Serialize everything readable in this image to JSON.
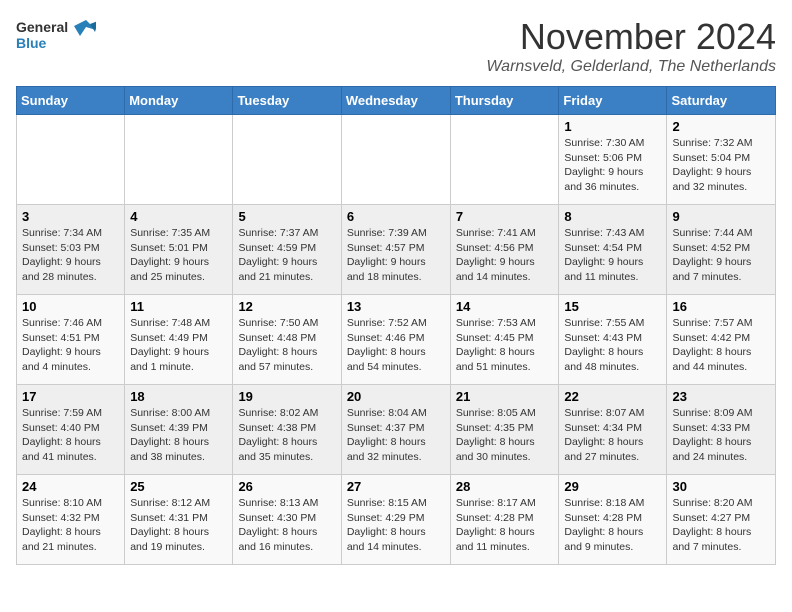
{
  "logo": {
    "line1": "General",
    "line2": "Blue"
  },
  "title": "November 2024",
  "location": "Warnsveld, Gelderland, The Netherlands",
  "weekdays": [
    "Sunday",
    "Monday",
    "Tuesday",
    "Wednesday",
    "Thursday",
    "Friday",
    "Saturday"
  ],
  "weeks": [
    [
      {
        "day": "",
        "info": ""
      },
      {
        "day": "",
        "info": ""
      },
      {
        "day": "",
        "info": ""
      },
      {
        "day": "",
        "info": ""
      },
      {
        "day": "",
        "info": ""
      },
      {
        "day": "1",
        "info": "Sunrise: 7:30 AM\nSunset: 5:06 PM\nDaylight: 9 hours and 36 minutes."
      },
      {
        "day": "2",
        "info": "Sunrise: 7:32 AM\nSunset: 5:04 PM\nDaylight: 9 hours and 32 minutes."
      }
    ],
    [
      {
        "day": "3",
        "info": "Sunrise: 7:34 AM\nSunset: 5:03 PM\nDaylight: 9 hours and 28 minutes."
      },
      {
        "day": "4",
        "info": "Sunrise: 7:35 AM\nSunset: 5:01 PM\nDaylight: 9 hours and 25 minutes."
      },
      {
        "day": "5",
        "info": "Sunrise: 7:37 AM\nSunset: 4:59 PM\nDaylight: 9 hours and 21 minutes."
      },
      {
        "day": "6",
        "info": "Sunrise: 7:39 AM\nSunset: 4:57 PM\nDaylight: 9 hours and 18 minutes."
      },
      {
        "day": "7",
        "info": "Sunrise: 7:41 AM\nSunset: 4:56 PM\nDaylight: 9 hours and 14 minutes."
      },
      {
        "day": "8",
        "info": "Sunrise: 7:43 AM\nSunset: 4:54 PM\nDaylight: 9 hours and 11 minutes."
      },
      {
        "day": "9",
        "info": "Sunrise: 7:44 AM\nSunset: 4:52 PM\nDaylight: 9 hours and 7 minutes."
      }
    ],
    [
      {
        "day": "10",
        "info": "Sunrise: 7:46 AM\nSunset: 4:51 PM\nDaylight: 9 hours and 4 minutes."
      },
      {
        "day": "11",
        "info": "Sunrise: 7:48 AM\nSunset: 4:49 PM\nDaylight: 9 hours and 1 minute."
      },
      {
        "day": "12",
        "info": "Sunrise: 7:50 AM\nSunset: 4:48 PM\nDaylight: 8 hours and 57 minutes."
      },
      {
        "day": "13",
        "info": "Sunrise: 7:52 AM\nSunset: 4:46 PM\nDaylight: 8 hours and 54 minutes."
      },
      {
        "day": "14",
        "info": "Sunrise: 7:53 AM\nSunset: 4:45 PM\nDaylight: 8 hours and 51 minutes."
      },
      {
        "day": "15",
        "info": "Sunrise: 7:55 AM\nSunset: 4:43 PM\nDaylight: 8 hours and 48 minutes."
      },
      {
        "day": "16",
        "info": "Sunrise: 7:57 AM\nSunset: 4:42 PM\nDaylight: 8 hours and 44 minutes."
      }
    ],
    [
      {
        "day": "17",
        "info": "Sunrise: 7:59 AM\nSunset: 4:40 PM\nDaylight: 8 hours and 41 minutes."
      },
      {
        "day": "18",
        "info": "Sunrise: 8:00 AM\nSunset: 4:39 PM\nDaylight: 8 hours and 38 minutes."
      },
      {
        "day": "19",
        "info": "Sunrise: 8:02 AM\nSunset: 4:38 PM\nDaylight: 8 hours and 35 minutes."
      },
      {
        "day": "20",
        "info": "Sunrise: 8:04 AM\nSunset: 4:37 PM\nDaylight: 8 hours and 32 minutes."
      },
      {
        "day": "21",
        "info": "Sunrise: 8:05 AM\nSunset: 4:35 PM\nDaylight: 8 hours and 30 minutes."
      },
      {
        "day": "22",
        "info": "Sunrise: 8:07 AM\nSunset: 4:34 PM\nDaylight: 8 hours and 27 minutes."
      },
      {
        "day": "23",
        "info": "Sunrise: 8:09 AM\nSunset: 4:33 PM\nDaylight: 8 hours and 24 minutes."
      }
    ],
    [
      {
        "day": "24",
        "info": "Sunrise: 8:10 AM\nSunset: 4:32 PM\nDaylight: 8 hours and 21 minutes."
      },
      {
        "day": "25",
        "info": "Sunrise: 8:12 AM\nSunset: 4:31 PM\nDaylight: 8 hours and 19 minutes."
      },
      {
        "day": "26",
        "info": "Sunrise: 8:13 AM\nSunset: 4:30 PM\nDaylight: 8 hours and 16 minutes."
      },
      {
        "day": "27",
        "info": "Sunrise: 8:15 AM\nSunset: 4:29 PM\nDaylight: 8 hours and 14 minutes."
      },
      {
        "day": "28",
        "info": "Sunrise: 8:17 AM\nSunset: 4:28 PM\nDaylight: 8 hours and 11 minutes."
      },
      {
        "day": "29",
        "info": "Sunrise: 8:18 AM\nSunset: 4:28 PM\nDaylight: 8 hours and 9 minutes."
      },
      {
        "day": "30",
        "info": "Sunrise: 8:20 AM\nSunset: 4:27 PM\nDaylight: 8 hours and 7 minutes."
      }
    ]
  ]
}
